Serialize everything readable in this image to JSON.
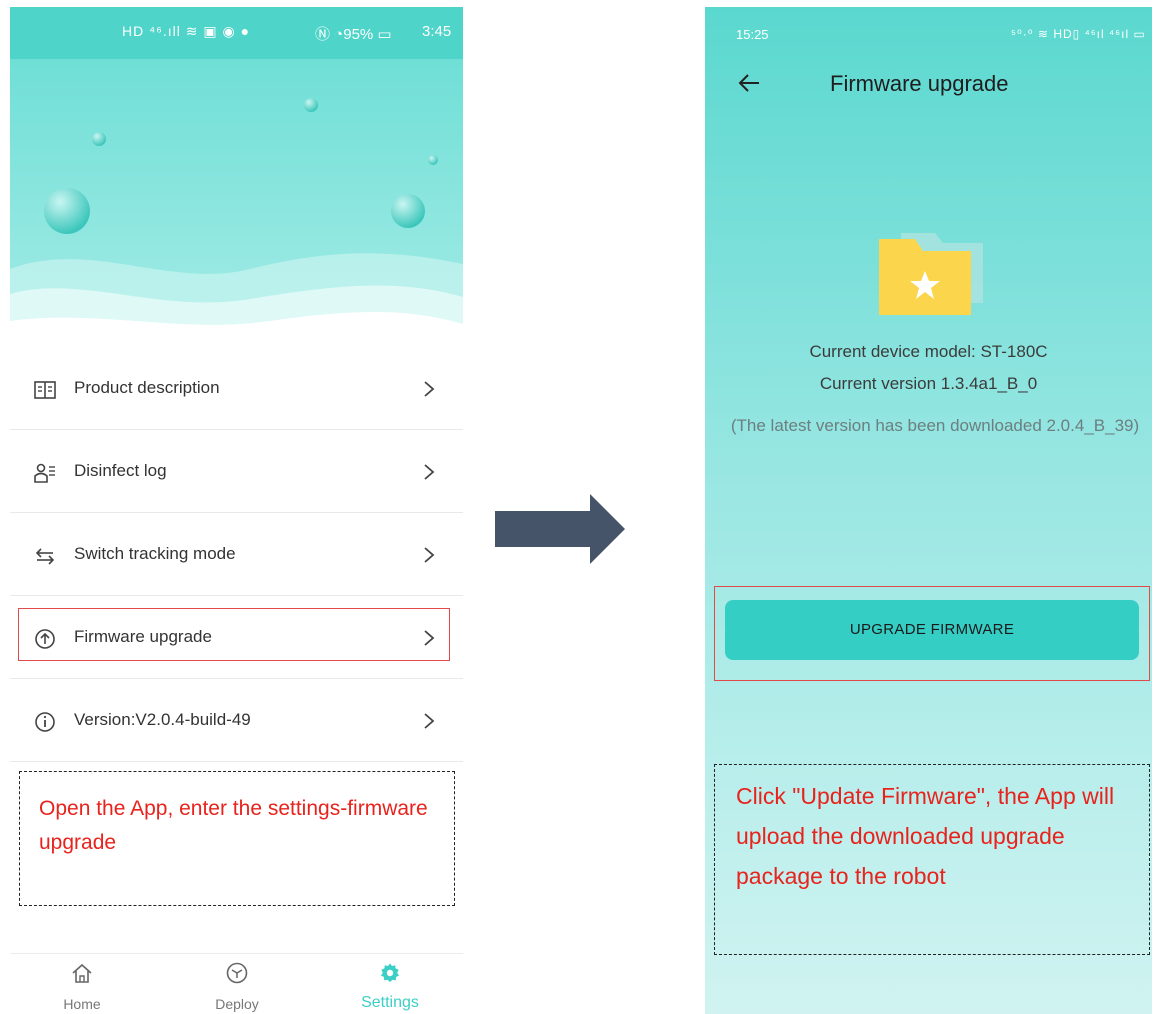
{
  "left_screen": {
    "status_bar": {
      "icons_text": "HD ⁴⁶.ıll ≋ ▣ ◉ ●",
      "right_text": "Ⓝ ◔95% ▭",
      "time": "3:45"
    },
    "menu": [
      {
        "label": "Product description",
        "icon": "book-icon"
      },
      {
        "label": "Disinfect log",
        "icon": "log-icon"
      },
      {
        "label": "Switch tracking mode",
        "icon": "swap-icon"
      },
      {
        "label": "Firmware upgrade",
        "icon": "upload-circle-icon"
      },
      {
        "label": "Version:V2.0.4-build-49",
        "icon": "info-icon"
      }
    ],
    "note": "Open the App, enter the settings-firmware upgrade",
    "tabs": [
      {
        "label": "Home",
        "icon": "home-icon"
      },
      {
        "label": "Deploy",
        "icon": "cube-icon"
      },
      {
        "label": "Settings",
        "icon": "gear-icon",
        "active": true
      }
    ]
  },
  "right_screen": {
    "status_bar": {
      "time": "15:25",
      "icons_text": "⁵⁰·⁰ ≋ HD▯ ⁴⁶ıl ⁴⁶ıl ▭"
    },
    "title": "Firmware upgrade",
    "device_model": "Current device model: ST-180C",
    "current_version": "Current version 1.3.4a1_B_0",
    "latest_note": "(The latest version has been downloaded 2.0.4_B_39)",
    "upgrade_button": "UPGRADE FIRMWARE",
    "note": "Click \"Update Firmware\", the App will upload the downloaded upgrade package to the robot"
  },
  "colors": {
    "teal": "#4fd4c9",
    "accent": "#35cec5",
    "highlight_red": "#e24a4a",
    "note_red": "#e8231d",
    "arrow": "#46546a"
  }
}
